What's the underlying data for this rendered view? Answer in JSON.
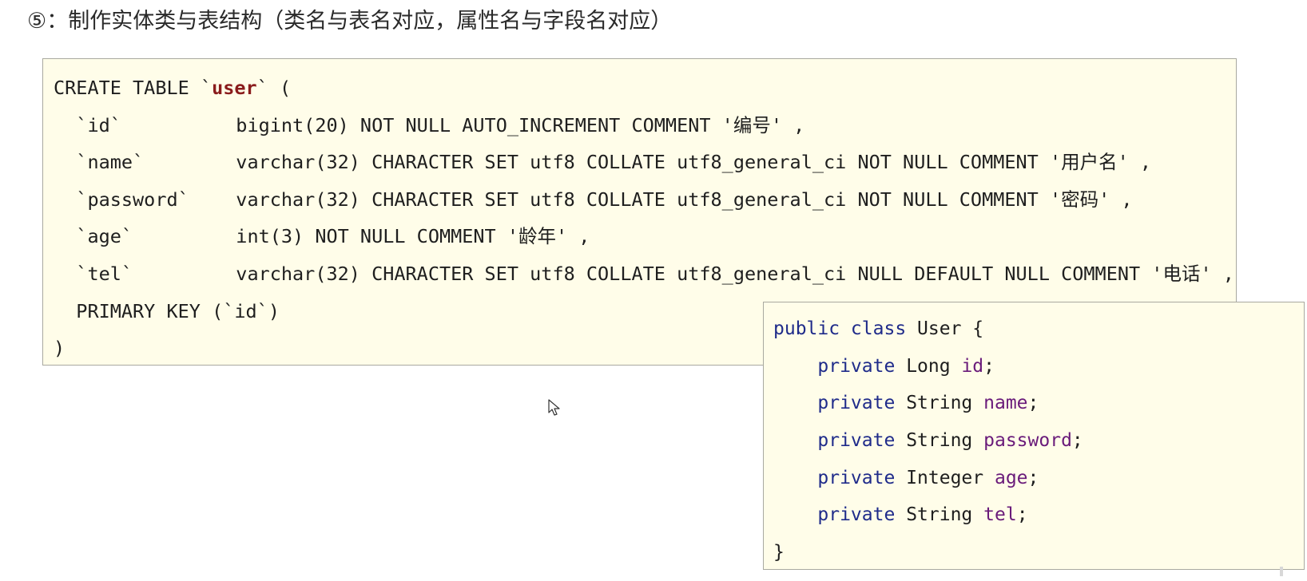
{
  "heading": "⑤：制作实体类与表结构（类名与表名对应，属性名与字段名对应）",
  "sql": {
    "line1_prefix": "CREATE TABLE `",
    "table_name": "user",
    "line1_suffix": "` (",
    "columns": [
      {
        "name": "`id`",
        "def": "bigint(20) NOT NULL AUTO_INCREMENT COMMENT '编号' ,"
      },
      {
        "name": "`name`",
        "def": "varchar(32) CHARACTER SET utf8 COLLATE utf8_general_ci NOT NULL COMMENT '用户名' ,"
      },
      {
        "name": "`password`",
        "def": "varchar(32) CHARACTER SET utf8 COLLATE utf8_general_ci NOT NULL COMMENT '密码' ,"
      },
      {
        "name": "`age`",
        "def": "int(3) NOT NULL COMMENT '龄年' ,"
      },
      {
        "name": "`tel`",
        "def": "varchar(32) CHARACTER SET utf8 COLLATE utf8_general_ci NULL DEFAULT NULL COMMENT '电话' ,"
      }
    ],
    "primary_key": "PRIMARY KEY (`id`)",
    "close": ")"
  },
  "java": {
    "decl_keyword": "public class",
    "class_name": "User {",
    "fields": [
      {
        "modifier": "private",
        "type": "Long",
        "name": "id"
      },
      {
        "modifier": "private",
        "type": "String",
        "name": "name"
      },
      {
        "modifier": "private",
        "type": "String",
        "name": "password"
      },
      {
        "modifier": "private",
        "type": "Integer",
        "name": "age"
      },
      {
        "modifier": "private",
        "type": "String",
        "name": "tel"
      }
    ],
    "close": "}"
  },
  "colors": {
    "code_background": "#fffde9",
    "table_name": "#8a1c1c",
    "java_keyword": "#1f2b8a",
    "java_field": "#6a1b7a"
  },
  "icons": [
    "mouse-pointer-icon"
  ]
}
